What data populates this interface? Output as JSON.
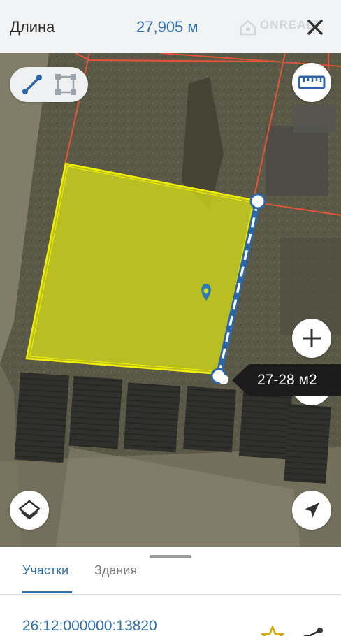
{
  "header": {
    "measure_label": "Длина",
    "measure_value": "27,905 м",
    "watermark_text": "ONREALT",
    "close_icon": "close-icon"
  },
  "map": {
    "mode_buttons": [
      {
        "name": "line-measure-icon",
        "active": true
      },
      {
        "name": "area-measure-icon",
        "active": false
      }
    ],
    "ruler_icon": "ruler-icon",
    "zoom_in_icon": "plus-icon",
    "layers_icon": "layers-icon",
    "locate_icon": "navigation-arrow-icon",
    "area_tooltip": "27-28 м2",
    "colors": {
      "parcel_fill": "#d4dc18",
      "parcel_border": "#f2f000",
      "measure_line": "#2c66a8",
      "cadastre_lines": "#e2553a",
      "accent": "#2e6fb0"
    }
  },
  "sheet": {
    "tabs": [
      {
        "label": "Участки",
        "active": true
      },
      {
        "label": "Здания",
        "active": false
      }
    ],
    "cadastral_number": "26:12:000000:13820",
    "star_icon": "star-icon",
    "share_icon": "share-icon"
  }
}
